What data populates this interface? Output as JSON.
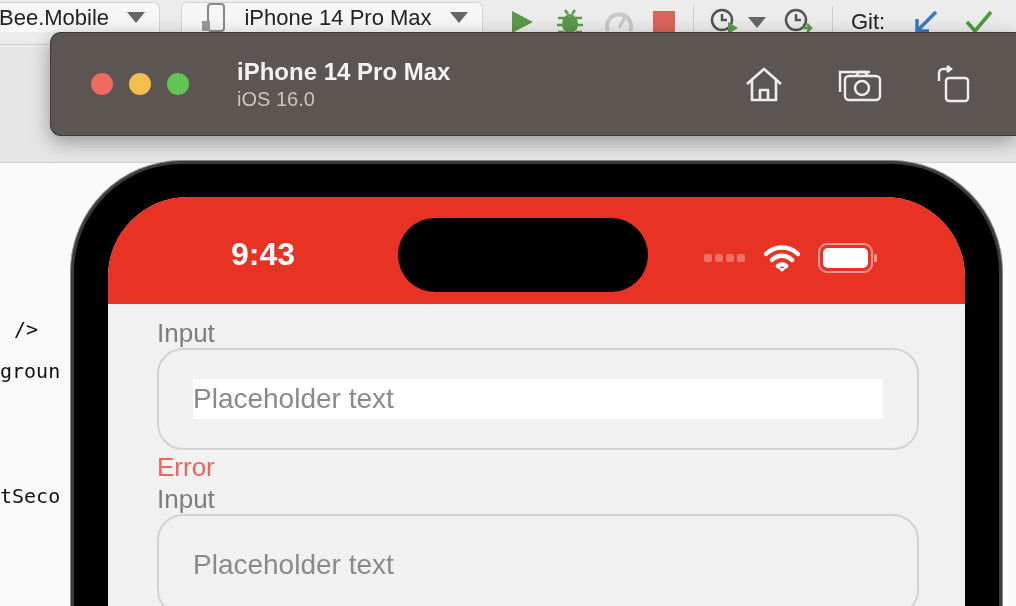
{
  "toolbar": {
    "run_configuration": "Bee.Mobile",
    "device": "iPhone 14 Pro Max",
    "vcs_label": "Git:"
  },
  "editor_lines": [
    "/>",
    "groun",
    "tSeco"
  ],
  "simulator": {
    "title": "iPhone 14 Pro Max",
    "subtitle": "iOS 16.0"
  },
  "status_bar": {
    "time": "9:43"
  },
  "form": [
    {
      "label": "Input",
      "placeholder": "Placeholder text",
      "focused": true,
      "error": "Error"
    },
    {
      "label": "Input",
      "placeholder": "Placeholder text",
      "focused": false
    }
  ]
}
